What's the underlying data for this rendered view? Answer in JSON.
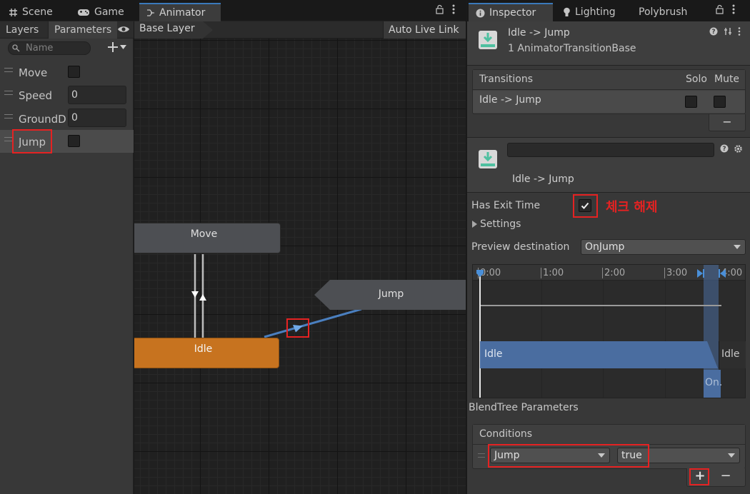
{
  "tabs_left": {
    "scene": "Scene",
    "game": "Game",
    "animator": "Animator"
  },
  "params_panel": {
    "tab_layers": "Layers",
    "tab_parameters": "Parameters",
    "search_placeholder": "Name",
    "params": [
      {
        "name": "Move",
        "type": "bool"
      },
      {
        "name": "Speed",
        "type": "float",
        "value": "0"
      },
      {
        "name": "GroundDi",
        "type": "float",
        "value": "0"
      },
      {
        "name": "Jump",
        "type": "bool"
      }
    ]
  },
  "graph": {
    "breadcrumb": "Base Layer",
    "auto_live_link": "Auto Live Link",
    "nodes": {
      "move": "Move",
      "jump": "Jump",
      "idle": "Idle"
    }
  },
  "inspector": {
    "tabs": {
      "inspector": "Inspector",
      "lighting": "Lighting",
      "polybrush": "Polybrush"
    },
    "header_title": "Idle -> Jump",
    "header_subtitle": "1 AnimatorTransitionBase",
    "transitions": {
      "header": "Transitions",
      "solo": "Solo",
      "mute": "Mute",
      "rows": [
        {
          "label": "Idle -> Jump"
        }
      ],
      "remove": "−"
    },
    "transition_name": "Idle -> Jump",
    "has_exit_time_label": "Has Exit Time",
    "has_exit_time_checked": true,
    "annotation": "체크 해제",
    "settings_label": "Settings",
    "preview_destination_label": "Preview destination",
    "preview_destination_value": "OnJump",
    "timeline": {
      "ticks": [
        "0:00",
        "1:00",
        "2:00",
        "3:00",
        "4:00"
      ],
      "source_label": "Idle",
      "dest_label": "On.",
      "tail_label": "Idle"
    },
    "blendtree_label": "BlendTree Parameters",
    "conditions": {
      "header": "Conditions",
      "param": "Jump",
      "value": "true",
      "add": "+",
      "remove": "−"
    }
  },
  "colors": {
    "accent": "#3a79bb",
    "idle_node": "#c7731f",
    "annotation_red": "#e52222",
    "timeline_blue": "#4a6da0"
  }
}
